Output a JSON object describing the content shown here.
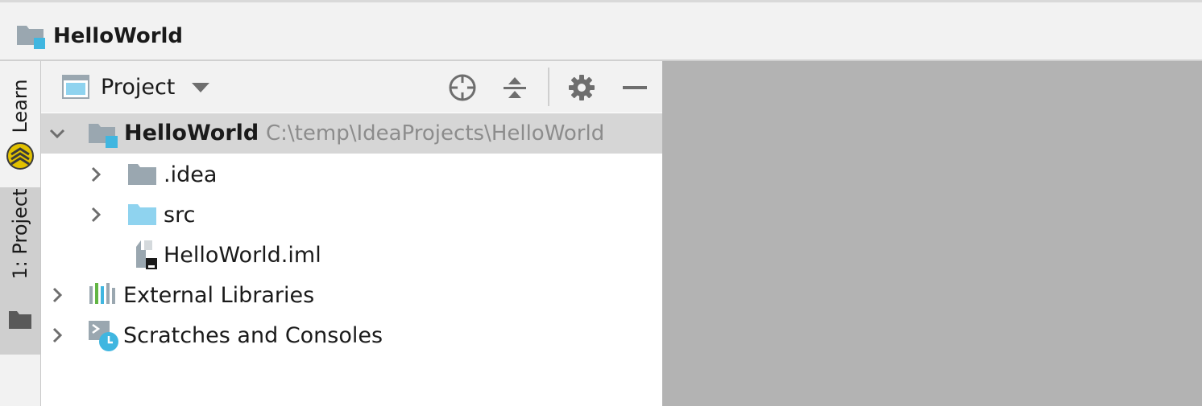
{
  "window": {
    "title": "HelloWorld"
  },
  "tool_strip": {
    "learn_label": "Learn",
    "project_label": "1: Project"
  },
  "project_panel": {
    "view_selector": "Project",
    "tree": [
      {
        "name": "HelloWorld",
        "path": "C:\\temp\\IdeaProjects\\HelloWorld",
        "expanded": true,
        "selected": true,
        "icon": "module-folder-icon"
      },
      {
        "name": ".idea",
        "icon": "folder-icon"
      },
      {
        "name": "src",
        "icon": "source-folder-icon"
      },
      {
        "name": "HelloWorld.iml",
        "icon": "iml-file-icon"
      },
      {
        "name": "External Libraries",
        "icon": "libraries-icon"
      },
      {
        "name": "Scratches and Consoles",
        "icon": "scratches-icon"
      }
    ]
  },
  "colors": {
    "accent_blue": "#40b6e0",
    "folder_gray": "#9aa7b0",
    "source_folder": "#8fd3ef",
    "selection": "#d6d6d6",
    "editor_bg": "#b3b3b3"
  }
}
